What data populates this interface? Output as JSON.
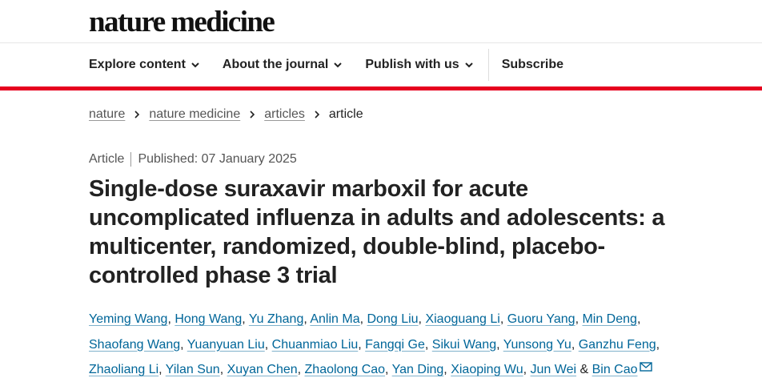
{
  "site": {
    "logo": "nature medicine"
  },
  "nav": {
    "items": [
      {
        "label": "Explore content"
      },
      {
        "label": "About the journal"
      },
      {
        "label": "Publish with us"
      }
    ],
    "subscribe": "Subscribe"
  },
  "breadcrumb": {
    "items": [
      "nature",
      "nature medicine",
      "articles"
    ],
    "current": "article"
  },
  "article": {
    "type": "Article",
    "published": "Published: 07 January 2025",
    "title": "Single-dose suraxavir marboxil for acute uncomplicated influenza in adults and adolescents: a multicenter, randomized, double-blind, placebo-controlled phase 3 trial",
    "authors": [
      "Yeming Wang",
      "Hong Wang",
      "Yu Zhang",
      "Anlin Ma",
      "Dong Liu",
      "Xiaoguang Li",
      "Guoru Yang",
      "Min Deng",
      "Shaofang Wang",
      "Yuanyuan Liu",
      "Chuanmiao Liu",
      "Fangqi Ge",
      "Sikui Wang",
      "Yunsong Yu",
      "Ganzhu Feng",
      "Zhaoliang Li",
      "Yilan Sun",
      "Xuyan Chen",
      "Zhaolong Cao",
      "Yan Ding",
      "Xiaoping Wu",
      "Jun Wei",
      "Bin Cao"
    ],
    "last_author_joiner": "&"
  },
  "colors": {
    "accent_red": "#e6001f",
    "link_blue": "#006699"
  },
  "icons": {
    "chevron": "chevron-down-icon",
    "crumb": "chevron-right-icon",
    "email": "mail-icon"
  }
}
